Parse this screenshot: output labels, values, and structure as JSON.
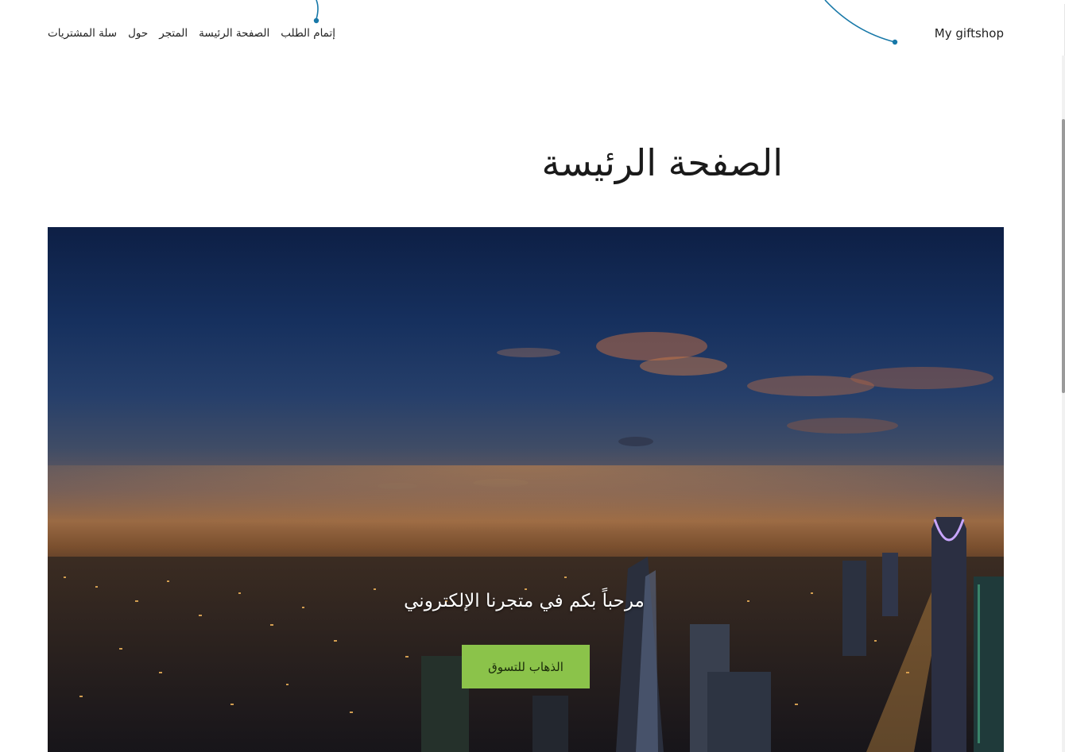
{
  "header": {
    "brand": "My giftshop",
    "nav": [
      {
        "label": "إتمام الطلب"
      },
      {
        "label": "الصفحة الرئيسة"
      },
      {
        "label": "المتجر"
      },
      {
        "label": "حول"
      },
      {
        "label": "سلة المشتريات"
      }
    ]
  },
  "main": {
    "title": "الصفحة الرئيسة"
  },
  "hero": {
    "headline": "مرحباً بكم في متجرنا الإلكتروني",
    "button_label": "الذهاب للتسوق"
  },
  "colors": {
    "button_bg": "#8bc34a",
    "callout_line": "#1778a8"
  }
}
